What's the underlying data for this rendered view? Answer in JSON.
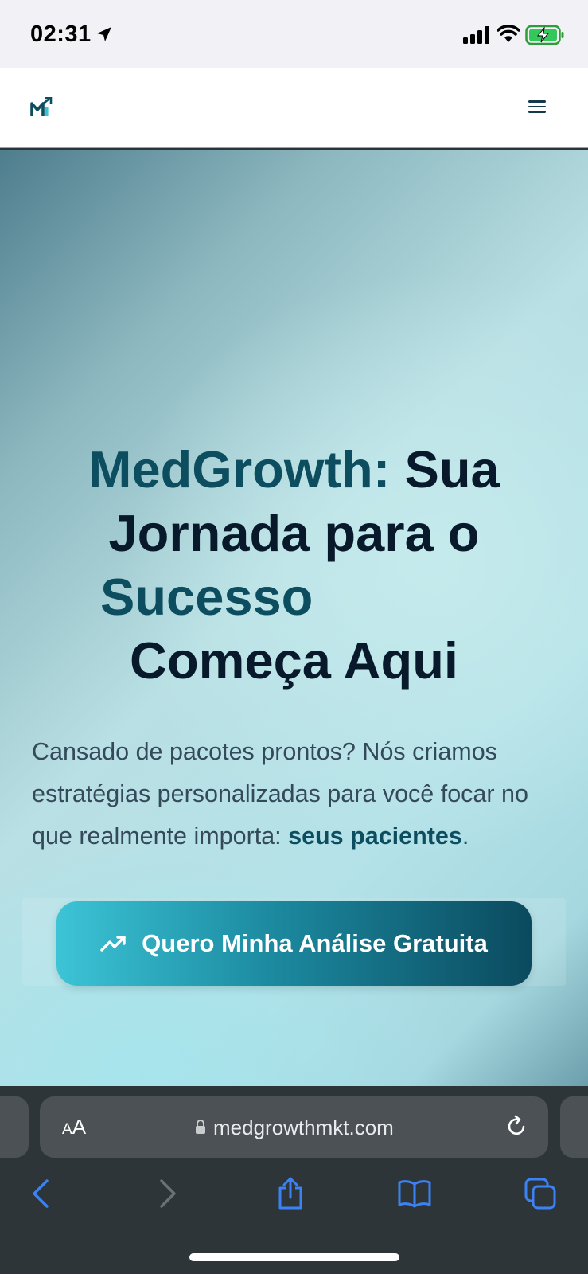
{
  "status_bar": {
    "time": "02:31",
    "icons": [
      "location-arrow-icon",
      "cellular-signal-icon",
      "wifi-icon",
      "battery-charging-icon"
    ]
  },
  "header": {
    "logo_icon": "medgrowth-logo-icon",
    "menu_icon": "hamburger-menu-icon"
  },
  "hero": {
    "title": {
      "accent_1": "MedGrowth:",
      "part_1": " Sua",
      "part_2": "Jornada para o",
      "accent_2": "Sucesso",
      "part_3": "Começa Aqui"
    },
    "subtitle_text": "Cansado de pacotes prontos? Nós criamos estratégias personalizadas para você focar no que realmente importa: ",
    "subtitle_highlight": "seus pacientes",
    "subtitle_end": ".",
    "cta_label": "Quero Minha Análise Gratuita",
    "cta_icon": "trending-up-icon"
  },
  "browser": {
    "aa_small": "A",
    "aa_large": "A",
    "url": "medgrowthmkt.com",
    "nav_icons": [
      "back-icon",
      "forward-icon",
      "share-icon",
      "bookmarks-icon",
      "tabs-icon"
    ]
  },
  "colors": {
    "accent": "#0c4e60",
    "title_dark": "#08192b",
    "cta_start": "#3cc4d6",
    "cta_end": "#0b4a5e",
    "safari_blue": "#3b82f6"
  }
}
